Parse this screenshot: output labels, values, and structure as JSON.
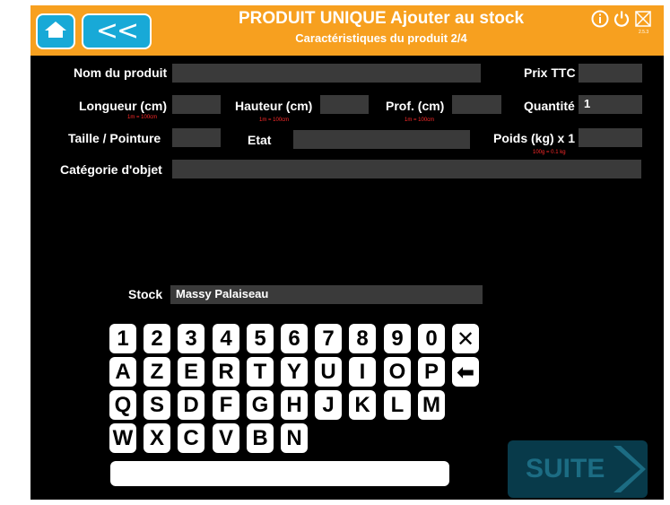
{
  "header": {
    "title": "PRODUIT UNIQUE Ajouter au stock",
    "subtitle": "Caractéristiques du produit 2/4",
    "back_label": "<<",
    "version": "2.5.3",
    "colors": {
      "bar": "#f7a01f",
      "button": "#18a9d7"
    }
  },
  "icons": {
    "home": "home-icon",
    "info": "info-icon",
    "power": "power-icon",
    "close": "close-box-icon"
  },
  "form": {
    "nom_label": "Nom du produit",
    "nom_value": "",
    "prix_label": "Prix TTC",
    "prix_value": "",
    "longueur_label": "Longueur (cm)",
    "longueur_hint": "1m = 100cm",
    "hauteur_label": "Hauteur (cm)",
    "hauteur_hint": "1m = 100cm",
    "prof_label": "Prof. (cm)",
    "prof_hint": "1m = 100cm",
    "quantite_label": "Quantité",
    "quantite_value": "1",
    "taille_label": "Taille / Pointure",
    "etat_label": "Etat",
    "poids_label": "Poids (kg) x 1",
    "poids_hint": "100g = 0.1 kg",
    "categorie_label": "Catégorie d'objet",
    "stock_label": "Stock",
    "stock_value": "Massy Palaiseau"
  },
  "keyboard": {
    "row1": [
      "1",
      "2",
      "3",
      "4",
      "5",
      "6",
      "7",
      "8",
      "9",
      "0",
      "✕"
    ],
    "row2": [
      "A",
      "Z",
      "E",
      "R",
      "T",
      "Y",
      "U",
      "I",
      "O",
      "P",
      "⬅"
    ],
    "row3": [
      "Q",
      "S",
      "D",
      "F",
      "G",
      "H",
      "J",
      "K",
      "L",
      "M"
    ],
    "row4": [
      "W",
      "X",
      "C",
      "V",
      "B",
      "N"
    ]
  },
  "suite_label": "SUITE"
}
